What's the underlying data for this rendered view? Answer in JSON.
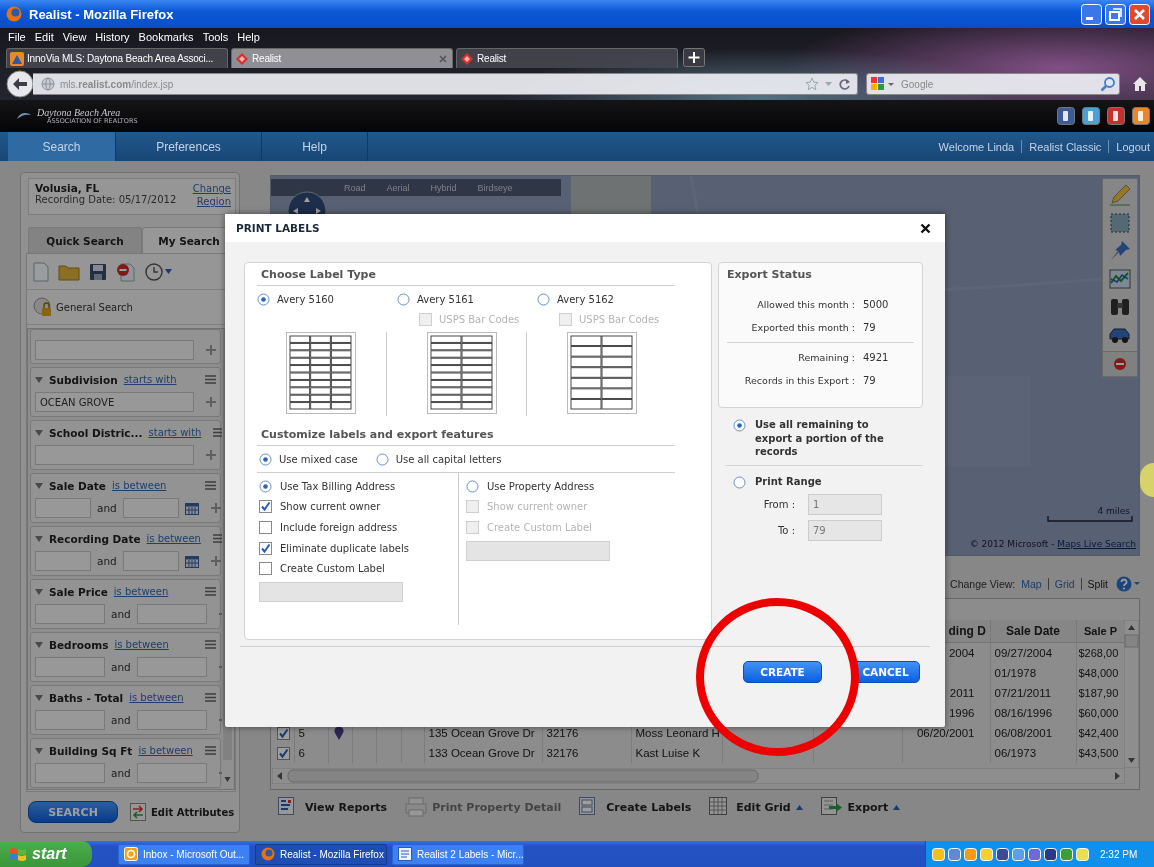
{
  "window": {
    "title": "Realist - Mozilla Firefox"
  },
  "menu": [
    "File",
    "Edit",
    "View",
    "History",
    "Bookmarks",
    "Tools",
    "Help"
  ],
  "browser_tabs": [
    {
      "label": "InnoVia MLS: Daytona Beach Area Associ...",
      "kind": "mls",
      "selected": false,
      "closable": false
    },
    {
      "label": "Realist",
      "kind": "app",
      "selected": true,
      "closable": true
    },
    {
      "label": "Realist",
      "kind": "app",
      "selected": false,
      "closable": false
    }
  ],
  "address": {
    "url": "mls.**realist.com**/index.jsp"
  },
  "web_search": {
    "placeholder": "Google"
  },
  "site": {
    "logo": "Daytona Beach Area",
    "tagline": "ASSOCIATION OF REALTORS"
  },
  "site_nav": [
    {
      "label": "Search",
      "selected": true
    },
    {
      "label": "Preferences",
      "selected": false
    },
    {
      "label": "Help",
      "selected": false
    }
  ],
  "user_links": [
    {
      "label": "Welcome Linda",
      "kind": "text"
    },
    {
      "label": "Realist Classic",
      "kind": "link"
    },
    {
      "label": "Logout",
      "kind": "link"
    }
  ],
  "region": {
    "name": "Volusia, FL",
    "date": "Recording Date: 05/17/2012",
    "link": "Change Region"
  },
  "search_tabs": [
    {
      "label": "Quick Search",
      "selected": false
    },
    {
      "label": "My Search",
      "selected": true
    }
  ],
  "general_search": "General Search",
  "criteria": [
    {
      "kind": "text"
    },
    {
      "kind": "text",
      "label": "Subdivision",
      "operator": "starts with",
      "value": "OCEAN GROVE"
    },
    {
      "kind": "text",
      "label": "School Distric...",
      "operator": "starts with"
    },
    {
      "kind": "date_range",
      "label": "Sale Date",
      "operator": "is between",
      "joiner": "and"
    },
    {
      "kind": "date_range",
      "label": "Recording Date",
      "operator": "is between",
      "joiner": "and"
    },
    {
      "kind": "range",
      "label": "Sale Price",
      "operator": "is between",
      "joiner": "and"
    },
    {
      "kind": "range",
      "label": "Bedrooms",
      "operator": "is between",
      "joiner": "and"
    },
    {
      "kind": "range",
      "label": "Baths - Total",
      "operator": "is between",
      "joiner": "and"
    },
    {
      "kind": "range",
      "label": "Building Sq Ft",
      "operator": "is between",
      "joiner": "and"
    }
  ],
  "search_button": "SEARCH",
  "edit_attributes": "Edit Attributes",
  "map": {
    "types": [
      "Road",
      "Aerial",
      "Hybrid",
      "Birdseye"
    ],
    "scale": "4 miles",
    "copyright": "© 2012 Microsoft - ",
    "copyright_link": "Maps Live Search"
  },
  "view": {
    "label": "Change View:",
    "options": [
      {
        "label": "Map",
        "selected": false
      },
      {
        "label": "Grid",
        "selected": false
      },
      {
        "label": "Split",
        "selected": true
      }
    ]
  },
  "grid": {
    "columns": {
      "recording": "ding D",
      "sale_date": "Sale Date",
      "sale_price": "Sale P"
    },
    "rows": [
      {
        "recording": "2004",
        "sale_date": "09/27/2004",
        "sale_price": "$268,00"
      },
      {
        "sale_date": "01/1978",
        "sale_price": "$48,000"
      },
      {
        "recording": "2011",
        "sale_date": "07/21/2011",
        "sale_price": "$187,90"
      },
      {
        "recording": "1996",
        "sale_date": "08/16/1996",
        "sale_price": "$60,000"
      },
      {
        "checked": true,
        "number": "5",
        "pinned": true,
        "address": "135 Ocean Grove Dr",
        "zip": "32176",
        "owner": "Moss Leonard H",
        "recording": "06/20/2001",
        "sale_date": "06/08/2001",
        "sale_price": "$42,400"
      },
      {
        "checked": true,
        "number": "6",
        "pinned": false,
        "address": "133 Ocean Grove Dr",
        "zip": "32176",
        "owner": "Kast Luise K",
        "sale_date": "06/1973",
        "sale_price": "$43,500"
      }
    ]
  },
  "grid_tools": [
    {
      "kind": "reports",
      "label": "View Reports",
      "disabled": false,
      "menu": false
    },
    {
      "kind": "print",
      "label": "Print Property Detail",
      "disabled": true,
      "menu": false
    },
    {
      "kind": "labels",
      "label": "Create Labels",
      "disabled": false,
      "menu": false
    },
    {
      "kind": "grid",
      "label": "Edit Grid",
      "disabled": false,
      "menu": true
    },
    {
      "kind": "export",
      "label": "Export",
      "disabled": false,
      "menu": true
    }
  ],
  "dialog": {
    "title": "PRINT LABELS",
    "label_heading": "Choose Label Type",
    "label_types": [
      {
        "label": "Avery 5160",
        "selected": true,
        "kind": "sheet_3x10"
      },
      {
        "label": "Avery 5161",
        "selected": false,
        "kind": "sheet_2x10",
        "barcode": {
          "label": "USPS Bar Codes",
          "checked": false,
          "disabled": true
        }
      },
      {
        "label": "Avery 5162",
        "selected": false,
        "kind": "sheet_2x7",
        "barcode": {
          "label": "USPS Bar Codes",
          "checked": false,
          "disabled": true
        }
      }
    ],
    "customize_heading": "Customize labels and export features",
    "case_options": [
      {
        "label": "Use mixed case",
        "selected": true
      },
      {
        "label": "Use all capital letters",
        "selected": false
      }
    ],
    "address_options": [
      {
        "label": "Use Tax Billing Address",
        "selected": true,
        "options": [
          {
            "label": "Show current owner",
            "checked": true,
            "disabled": false
          },
          {
            "label": "Include foreign address",
            "checked": false,
            "disabled": false
          },
          {
            "label": "Eliminate duplicate labels",
            "checked": true,
            "disabled": false
          },
          {
            "label": "Create Custom Label",
            "checked": false,
            "disabled": false
          }
        ],
        "custom_field": {
          "disabled": true
        }
      },
      {
        "label": "Use Property Address",
        "selected": false,
        "options": [
          {
            "label": "Show current owner",
            "checked": false,
            "disabled": true
          },
          {
            "label": "Create Custom Label",
            "checked": false,
            "disabled": true
          }
        ],
        "custom_field": {
          "disabled": true
        }
      }
    ],
    "export_status": {
      "heading": "Export Status",
      "groups": [
        [
          {
            "label": "Allowed this month :",
            "value": "5000"
          },
          {
            "label": "Exported this month :",
            "value": "79"
          }
        ],
        [
          {
            "label": "Remaining :",
            "value": "4921"
          },
          {
            "label": "Records in this Export :",
            "value": "79"
          }
        ]
      ]
    },
    "range_options": [
      {
        "label": "Use all remaining to export a portion of the records",
        "selected": true
      },
      {
        "label": "Print Range",
        "selected": false,
        "fields": [
          {
            "label": "From :",
            "value": "1",
            "disabled": true
          },
          {
            "label": "To :",
            "value": "79",
            "disabled": true
          }
        ]
      }
    ],
    "buttons": [
      "CREATE",
      "CANCEL"
    ]
  },
  "annotation": {
    "kind": "circle"
  },
  "taskbar": {
    "start": "start",
    "tasks": [
      {
        "label": "Inbox - Microsoft Out...",
        "kind": "mail",
        "selected": false
      },
      {
        "label": "Realist - Mozilla Firefox",
        "kind": "browser",
        "selected": true
      },
      {
        "label": "Realist 2 Labels - Micr...",
        "kind": "document",
        "selected": false
      }
    ],
    "clock": "2:32 PM"
  }
}
